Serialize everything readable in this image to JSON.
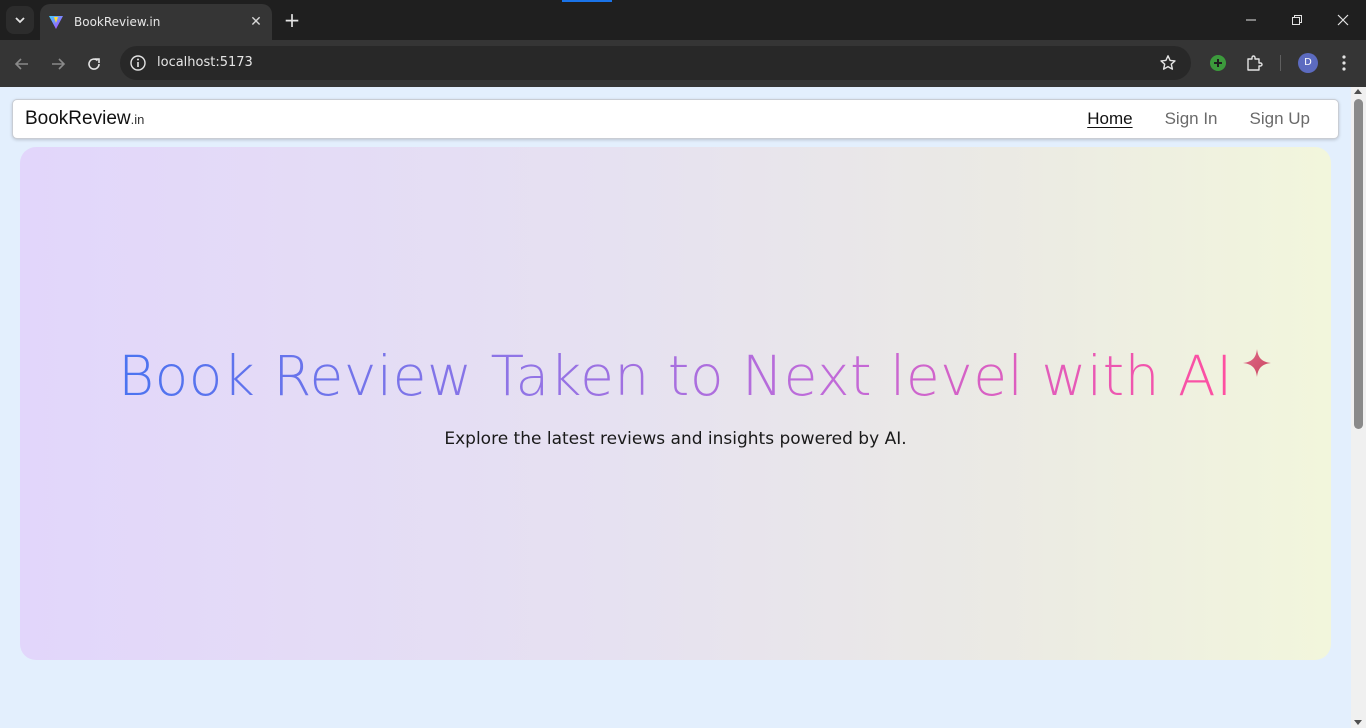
{
  "browser": {
    "tab_title": "BookReview.in",
    "new_tab_label": "+",
    "url": "localhost:5173",
    "profile_initial": "D"
  },
  "site": {
    "brand_name": "BookReview",
    "brand_suffix": ".in",
    "nav": [
      {
        "label": "Home",
        "active": true
      },
      {
        "label": "Sign In",
        "active": false
      },
      {
        "label": "Sign Up",
        "active": false
      }
    ]
  },
  "hero": {
    "title": "Book Review Taken to Next level with AI",
    "subtitle": "Explore the latest reviews and insights powered by AI.",
    "sparkle_icon": "sparkle-icon"
  },
  "colors": {
    "chrome_bg": "#1f1f1f",
    "page_bg": "#e3effd",
    "title_gradient_start": "#4a73f0",
    "title_gradient_end": "#ff4fa0"
  }
}
